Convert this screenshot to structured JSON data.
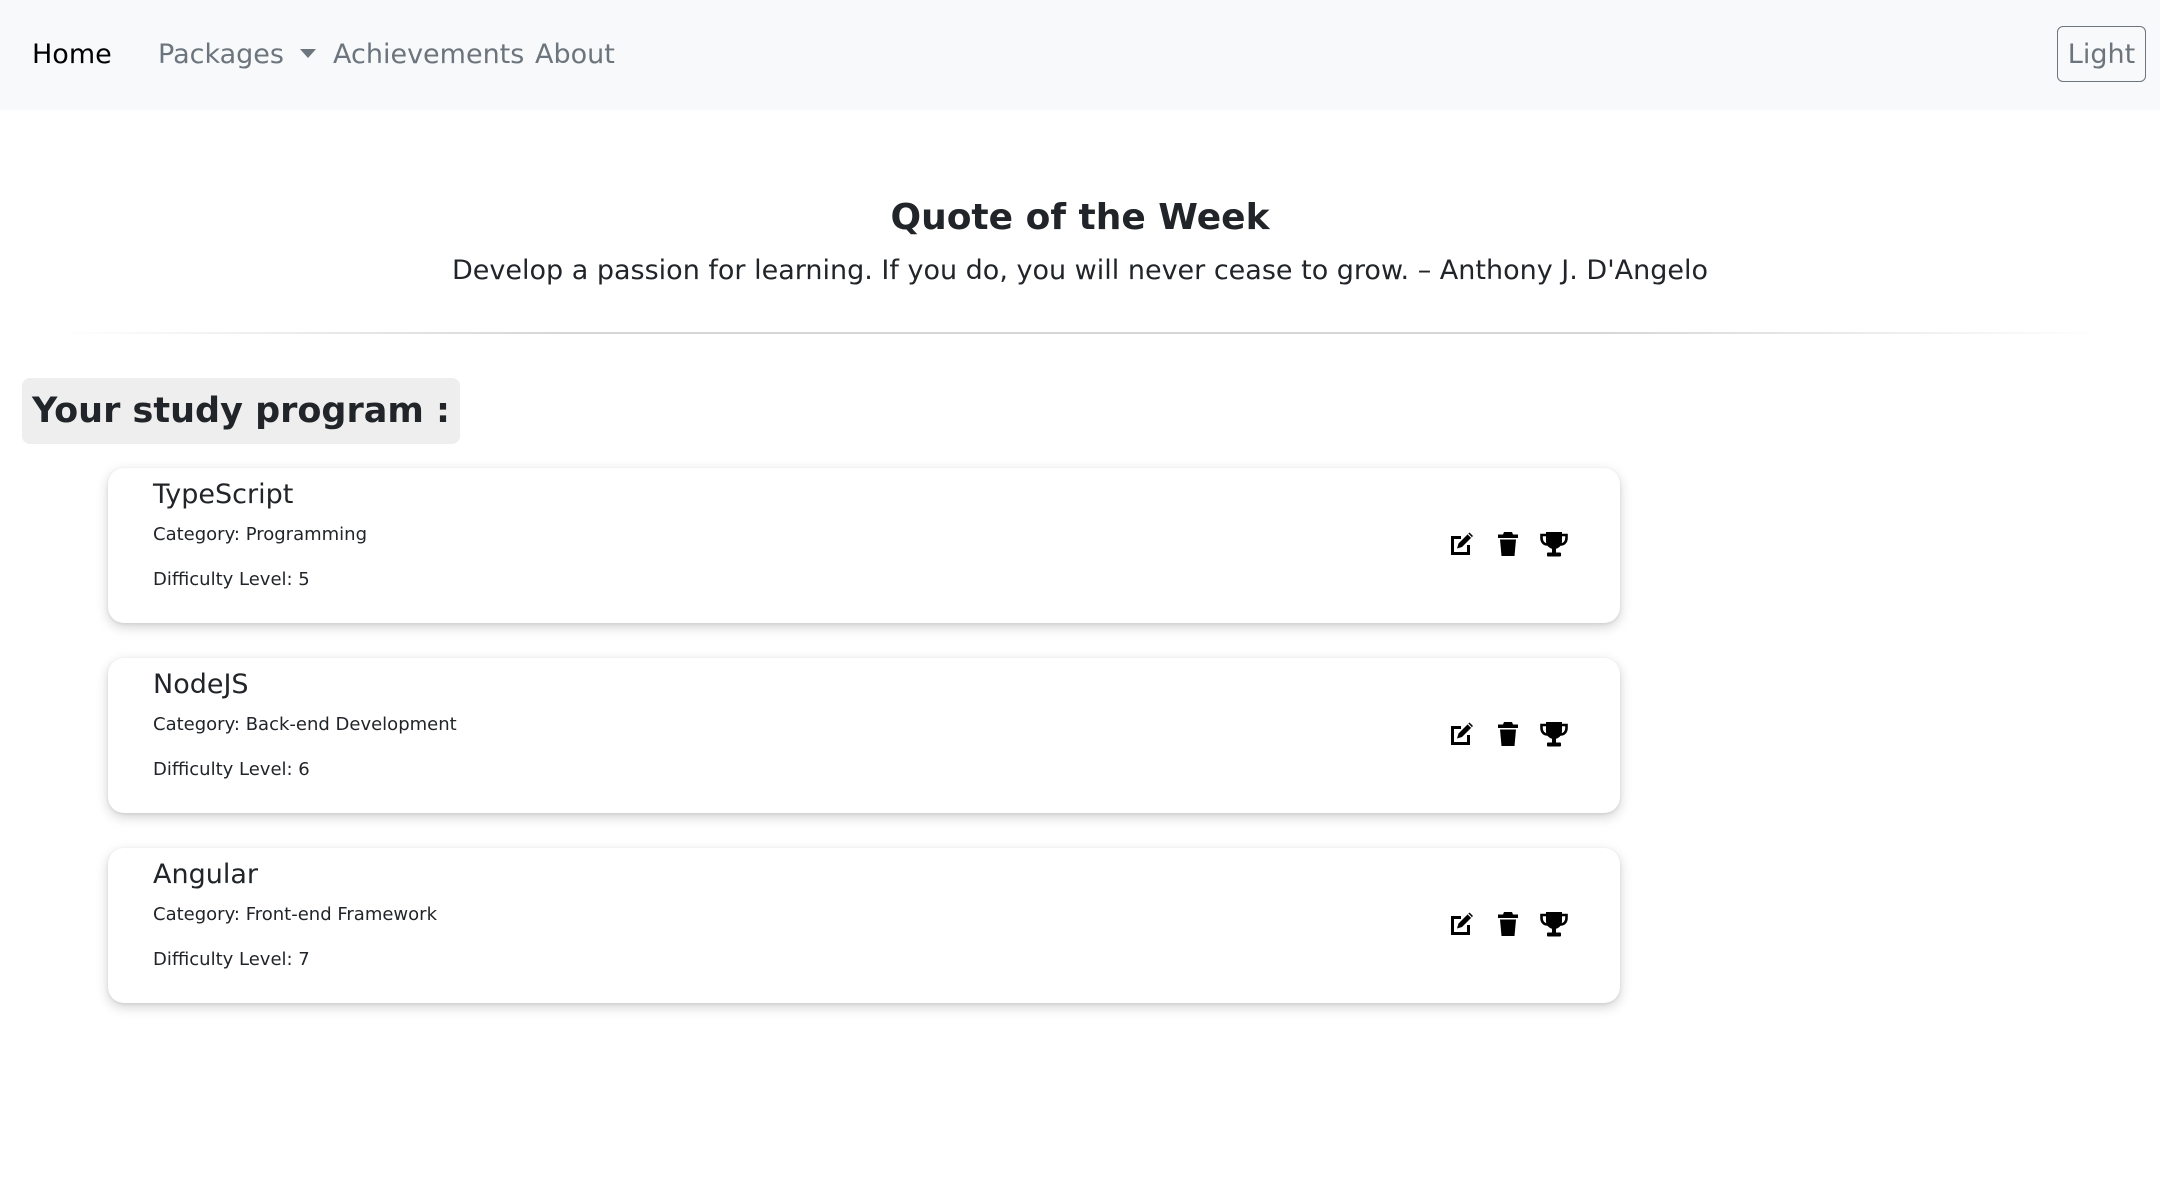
{
  "nav": {
    "home": "Home",
    "packages": "Packages",
    "achievements": "Achievements",
    "about": "About",
    "theme_toggle": "Light"
  },
  "quote": {
    "title": "Quote of the Week",
    "text": "Develop a passion for learning. If you do, you will never cease to grow. – Anthony J. D'Angelo"
  },
  "program": {
    "heading": "Your study program :",
    "courses": [
      {
        "name": "TypeScript",
        "category": "Category: Programming",
        "difficulty": "Difficulty Level: 5"
      },
      {
        "name": "NodeJS",
        "category": "Category: Back-end Development",
        "difficulty": "Difficulty Level: 6"
      },
      {
        "name": "Angular",
        "category": "Category: Front-end Framework",
        "difficulty": "Difficulty Level: 7"
      }
    ],
    "actions": [
      "edit-icon",
      "trash-icon",
      "trophy-icon"
    ]
  },
  "colors": {
    "navbar_bg": "#f8f9fa",
    "nav_active": "#000000",
    "nav_muted": "#6c757d",
    "heading_bg": "#eeeeee",
    "text": "#212529"
  }
}
